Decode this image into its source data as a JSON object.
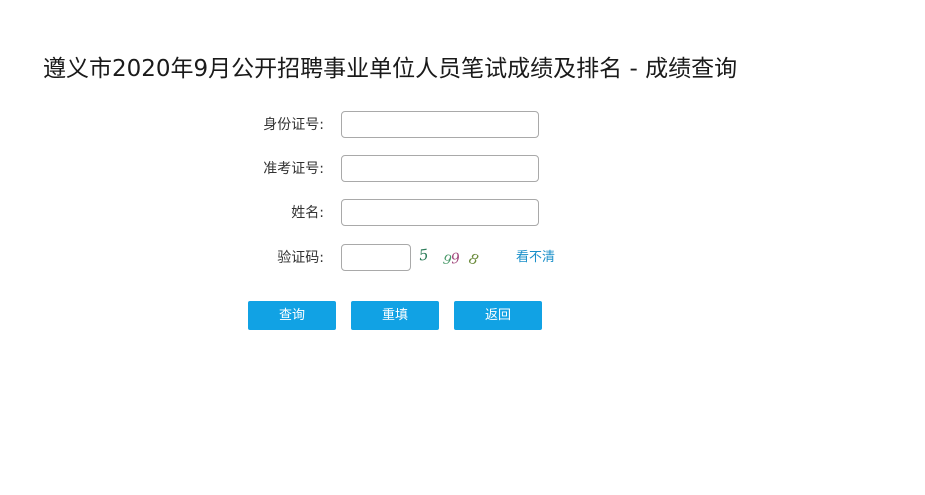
{
  "page": {
    "title": "遵义市2020年9月公开招聘事业单位人员笔试成绩及排名 - 成绩查询"
  },
  "form": {
    "id_card": {
      "label": "身份证号:",
      "value": "",
      "placeholder": ""
    },
    "ticket_number": {
      "label": "准考证号:",
      "value": "",
      "placeholder": ""
    },
    "name": {
      "label": "姓名:",
      "value": "",
      "placeholder": ""
    },
    "captcha": {
      "label": "验证码:",
      "value": "",
      "placeholder": "",
      "image_chars": [
        {
          "char": "5",
          "color": "#2e7d5b"
        },
        {
          "char": "9",
          "color": "#4a9a6a"
        },
        {
          "char": "9",
          "color": "#a0457a"
        },
        {
          "char": "8",
          "color": "#6a8a3a"
        }
      ],
      "refresh_label": "看不清"
    }
  },
  "buttons": {
    "query_label": "查询",
    "reset_label": "重填",
    "back_label": "返回"
  },
  "colors": {
    "button_bg": "#11a2e4",
    "link": "#1a8fc9",
    "input_border": "#a9a9a9"
  }
}
